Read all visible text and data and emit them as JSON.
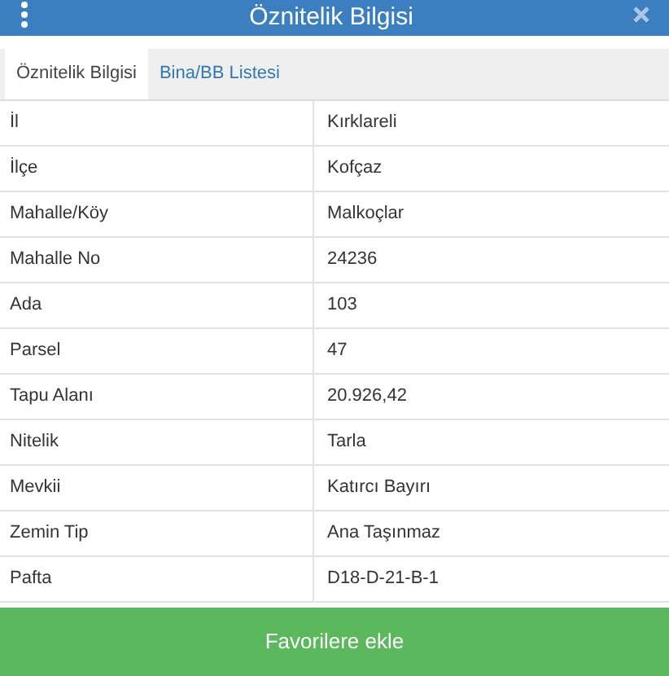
{
  "header": {
    "title": "Öznitelik Bilgisi"
  },
  "tabs": [
    {
      "label": "Öznitelik Bilgisi",
      "selected": true
    },
    {
      "label": "Bina/BB Listesi",
      "selected": false
    }
  ],
  "table": {
    "rows": [
      {
        "name": "İl",
        "value": "Kırklareli"
      },
      {
        "name": "İlçe",
        "value": "Kofçaz"
      },
      {
        "name": "Mahalle/Köy",
        "value": "Malkoçlar"
      },
      {
        "name": "Mahalle No",
        "value": "24236"
      },
      {
        "name": "Ada",
        "value": "103"
      },
      {
        "name": "Parsel",
        "value": "47"
      },
      {
        "name": "Tapu Alanı",
        "value": "20.926,42"
      },
      {
        "name": "Nitelik",
        "value": "Tarla"
      },
      {
        "name": "Mevkii",
        "value": "Katırcı Bayırı"
      },
      {
        "name": "Zemin Tip",
        "value": "Ana Taşınmaz"
      },
      {
        "name": "Pafta",
        "value": "D18-D-21-B-1"
      }
    ]
  },
  "footer_button": "Favorilere ekle"
}
